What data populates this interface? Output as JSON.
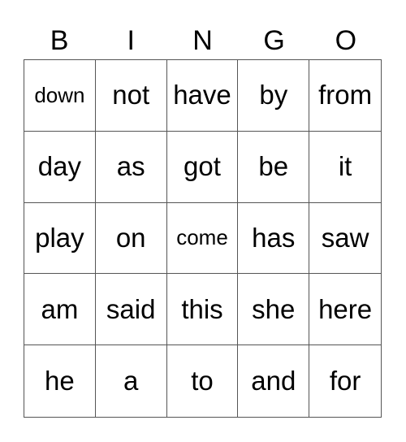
{
  "header": [
    "B",
    "I",
    "N",
    "G",
    "O"
  ],
  "rows": [
    [
      "down",
      "not",
      "have",
      "by",
      "from"
    ],
    [
      "day",
      "as",
      "got",
      "be",
      "it"
    ],
    [
      "play",
      "on",
      "come",
      "has",
      "saw"
    ],
    [
      "am",
      "said",
      "this",
      "she",
      "here"
    ],
    [
      "he",
      "a",
      "to",
      "and",
      "for"
    ]
  ]
}
